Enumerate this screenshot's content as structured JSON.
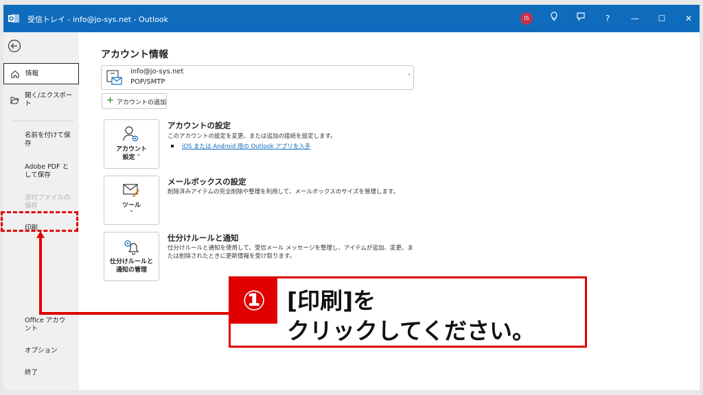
{
  "titlebar": {
    "title": "受信トレイ - info@jo-sys.net  -  Outlook",
    "avatar": "IS",
    "help": "?",
    "minimize": "—",
    "maximize": "☐",
    "close": "✕"
  },
  "sidebar": {
    "info": "情報",
    "open_export": "開く/エクスポート",
    "save_as": "名前を付けて保存",
    "adobe_pdf": "Adobe PDF として保存",
    "save_attachments": "添付ファイルの保存",
    "print": "印刷",
    "office_account": "Office アカウント",
    "options": "オプション",
    "exit": "終了"
  },
  "main": {
    "title": "アカウント情報",
    "account_email": "info@jo-sys.net",
    "account_type": "POP/SMTP",
    "add_account": "アカウントの追加",
    "sections": [
      {
        "tile_line1": "アカウント",
        "tile_line2": "設定 ˅",
        "title": "アカウントの設定",
        "desc": "このアカウントの設定を変更、または追加の接続を設定します。",
        "link": "iOS または Android 用の Outlook アプリを入手"
      },
      {
        "tile_line1": "ツール",
        "tile_line2": "˅",
        "title": "メールボックスの設定",
        "desc": "削除済みアイテムの完全削除や整理を利用して、メールボックスのサイズを管理します。"
      },
      {
        "tile_line1": "仕分けルールと",
        "tile_line2": "通知の管理",
        "title": "仕分けルールと通知",
        "desc": "仕分けルールと通知を使用して、受信メール メッセージを整理し、アイテムが追加、変更、または削除されたときに更新情報を受け取ります。"
      }
    ]
  },
  "callout": {
    "step": "①",
    "line1": "[印刷]を",
    "line2": "クリックしてください。"
  },
  "colors": {
    "titlebar": "#0f6cbd",
    "annotation_red": "#e00000",
    "avatar": "#c4314b"
  }
}
